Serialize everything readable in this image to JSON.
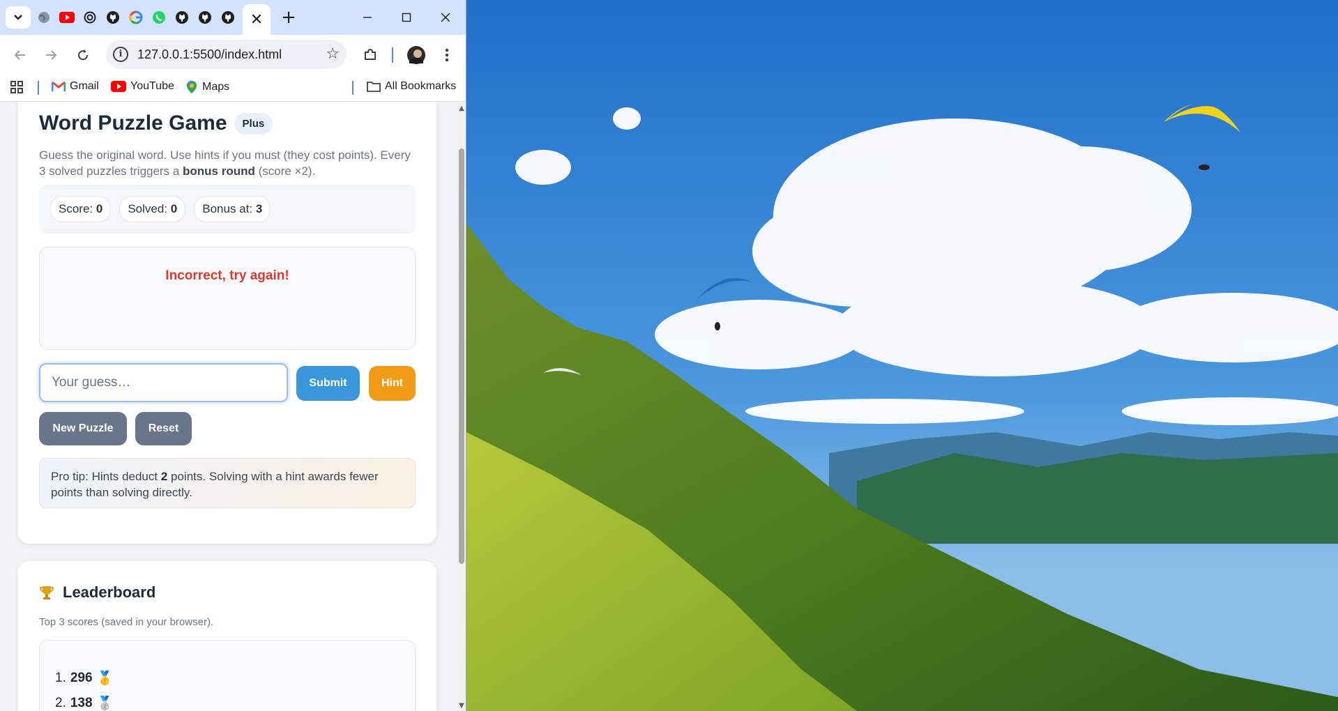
{
  "browser": {
    "url": "127.0.0.1:5500/index.html",
    "tab_favicons": [
      "globe-icon",
      "youtube-icon",
      "openai-icon",
      "github-icon",
      "google-icon",
      "whatsapp-icon",
      "github-icon",
      "github-icon",
      "github-icon"
    ],
    "bookmarks": [
      "Gmail",
      "YouTube",
      "Maps"
    ],
    "all_bookmarks": "All Bookmarks"
  },
  "game": {
    "title": "Word Puzzle Game",
    "badge": "Plus",
    "desc_part1": "Guess the original word. Use hints if you must (they cost points). Every 3 solved puzzles triggers a ",
    "desc_bold": "bonus round",
    "desc_part2": " (score ×2).",
    "stats": {
      "score_label": "Score:",
      "score_value": "0",
      "solved_label": "Solved:",
      "solved_value": "0",
      "bonus_label": "Bonus at:",
      "bonus_value": "3"
    },
    "feedback": "Incorrect, try again!",
    "guess_placeholder": "Your guess…",
    "buttons": {
      "submit": "Submit",
      "hint": "Hint",
      "new_puzzle": "New Puzzle",
      "reset": "Reset"
    },
    "tip_part1": "Pro tip: Hints deduct ",
    "tip_bold": "2",
    "tip_part2": " points. Solving with a hint awards fewer points than solving directly."
  },
  "leaderboard": {
    "title": "Leaderboard",
    "subtitle": "Top 3 scores (saved in your browser).",
    "entries": [
      {
        "rank": "1.",
        "score": "296",
        "medal": "🥇"
      },
      {
        "rank": "2.",
        "score": "138",
        "medal": "🥈"
      }
    ]
  },
  "colors": {
    "accent_blue": "#3a97db",
    "hint_orange": "#f29b16",
    "neutral_button": "#68758a",
    "error_red": "#dc3b2c"
  }
}
